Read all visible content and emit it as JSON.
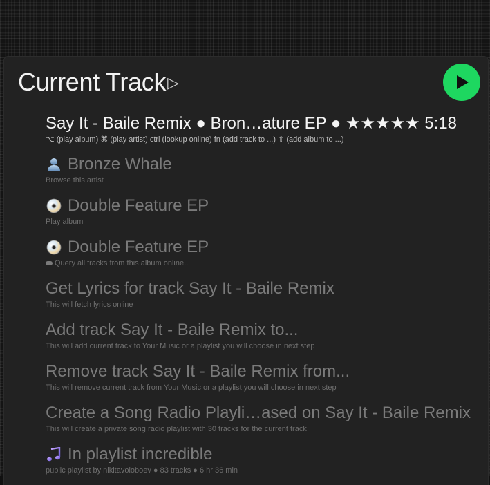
{
  "query": {
    "text": "Current Track"
  },
  "action_button": {
    "color": "#1ed760",
    "icon": "play-icon"
  },
  "results": [
    {
      "title": "Say It - Baile Remix ● Bron…ature EP ● ★★★★★ 5:18",
      "subtitle": "⌥ (play album) ⌘ (play artist) ctrl (lookup online) fn (add track to ...) ⇧ (add album to ...)",
      "icon": null
    },
    {
      "title": "Bronze Whale",
      "subtitle": "Browse this artist",
      "icon": "person-icon"
    },
    {
      "title": "Double Feature EP",
      "subtitle": "Play album",
      "icon": "cd-icon"
    },
    {
      "title": "Double Feature EP",
      "subtitle": "Query all tracks from this album online..",
      "icon": "cd-icon"
    },
    {
      "title": "Get Lyrics for track Say It - Baile Remix",
      "subtitle": "This will fetch lyrics online",
      "icon": null
    },
    {
      "title": "Add track Say It - Baile Remix to...",
      "subtitle": "This will add current track to Your Music or a playlist you will choose in next step",
      "icon": null
    },
    {
      "title": "Remove track Say It - Baile Remix from...",
      "subtitle": "This will remove current track from Your Music or a playlist you will choose in next step",
      "icon": null
    },
    {
      "title": "Create a Song Radio Playli…ased on Say It - Baile Remix",
      "subtitle": "This will create a private song radio playlist with 30 tracks for the current track",
      "icon": null
    },
    {
      "title": "In playlist incredible",
      "subtitle": "public playlist by nikitavoloboev ● 83 tracks ● 6 hr 36 min",
      "icon": "music-note-icon"
    }
  ]
}
